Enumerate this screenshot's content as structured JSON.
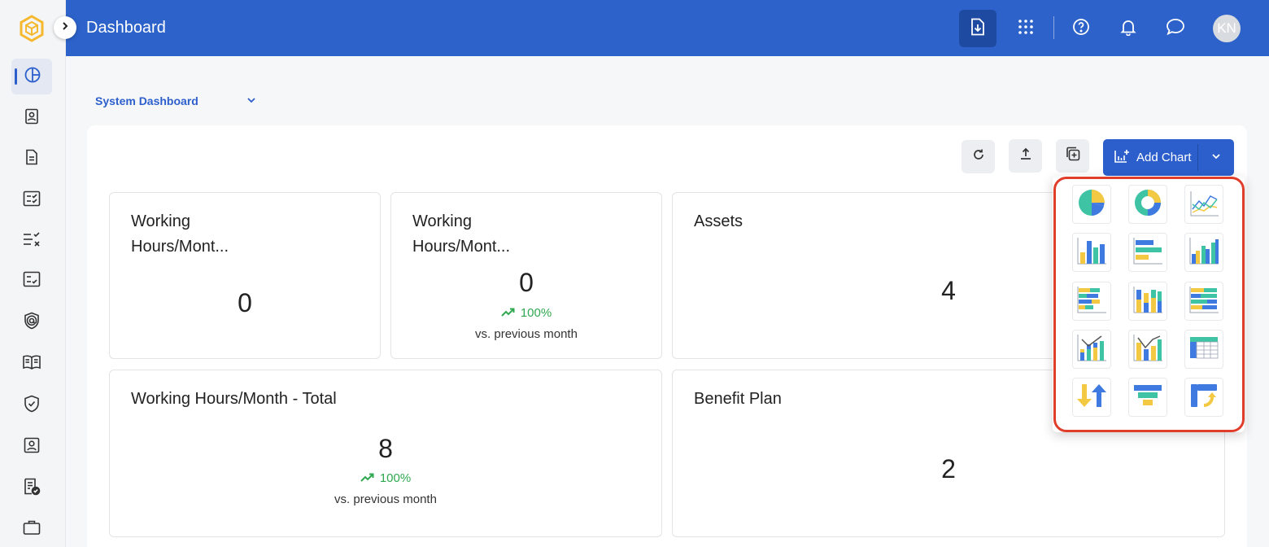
{
  "header": {
    "title": "Dashboard",
    "avatar_initials": "KN"
  },
  "sidebar": {
    "items": [
      {
        "icon": "dashboard-icon",
        "active": true
      },
      {
        "icon": "contact-card-icon"
      },
      {
        "icon": "document-icon"
      },
      {
        "icon": "checklist-icon"
      },
      {
        "icon": "tasks-list-icon"
      },
      {
        "icon": "approval-list-icon"
      },
      {
        "icon": "shield-at-icon"
      },
      {
        "icon": "book-icon"
      },
      {
        "icon": "shield-check-icon"
      },
      {
        "icon": "id-badge-icon"
      },
      {
        "icon": "report-check-icon"
      },
      {
        "icon": "briefcase-icon"
      }
    ]
  },
  "dashboard_select": {
    "value": "System Dashboard"
  },
  "toolbar": {
    "add_chart_label": "Add Chart"
  },
  "cards": [
    {
      "title": "Working Hours/Mont...",
      "value": "0"
    },
    {
      "title": "Working Hours/Mont...",
      "value": "0",
      "trend": "100%",
      "trend_label": "vs. previous month"
    },
    {
      "title": "Assets",
      "value": "4"
    },
    {
      "title": "Working Hours/Month - Total",
      "value": "8",
      "trend": "100%",
      "trend_label": "vs. previous month"
    },
    {
      "title": "Benefit Plan",
      "value": "2"
    }
  ],
  "chart_types": [
    "pie-chart-icon",
    "donut-chart-icon",
    "line-chart-icon",
    "column-chart-icon",
    "bar-chart-icon",
    "clustered-column-icon",
    "stacked-bar-icon",
    "stacked-column-icon",
    "stacked-bar-100-icon",
    "column-line-combo-icon",
    "stacked-column-line-icon",
    "table-chart-icon",
    "up-down-arrows-icon",
    "funnel-chart-icon",
    "flow-chart-icon"
  ],
  "colors": {
    "header": "#2c62c9",
    "primary": "#2c5fcc",
    "trend_up": "#2fa84f",
    "highlight_outline": "#e03d2b",
    "chart_teal": "#3fc3a5",
    "chart_blue": "#3f7ae0",
    "chart_yellow": "#f3c943"
  }
}
